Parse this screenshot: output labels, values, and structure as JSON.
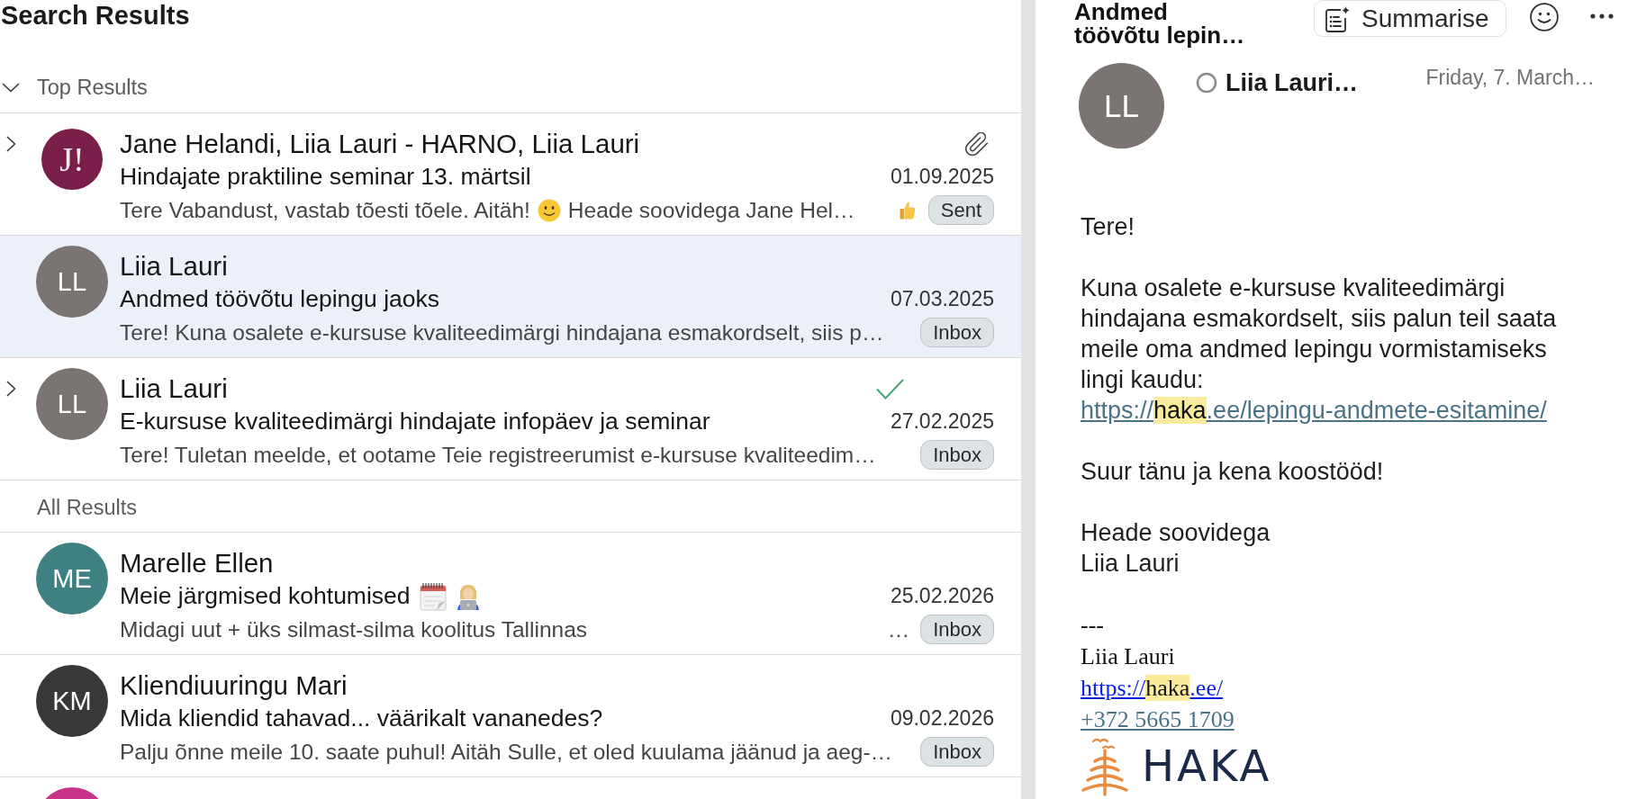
{
  "results": {
    "title": "Search Results",
    "sections": [
      {
        "label": "Top Results",
        "expanded": true,
        "rows": [
          {
            "sender": "Jane Helandi, Liia Lauri - HARNO, Liia Lauri",
            "avatar": {
              "kind": "logo",
              "initials": "J!",
              "color": "#7a1f4a"
            },
            "expanded": false,
            "selected": false,
            "attachment": true,
            "subject": [
              {
                "kind": "text",
                "text": "Hindajate praktiline seminar 13. märtsil"
              }
            ],
            "date": "01.09.2025",
            "preview": [
              {
                "kind": "text",
                "text": "Tere Vabandust, vastab tõesti tõele. Aitäh!"
              },
              {
                "kind": "smile"
              },
              {
                "kind": "text",
                "text": "Heade soovidega Jane Hel…"
              }
            ],
            "reaction": true,
            "folder": "Sent"
          },
          {
            "sender": "Liia Lauri",
            "avatar": {
              "kind": "initials",
              "initials": "LL",
              "color": "#7a7472"
            },
            "selected": true,
            "subject": [
              {
                "kind": "text",
                "text": "Andmed töövõtu lepingu jaoks"
              }
            ],
            "date": "07.03.2025",
            "preview": [
              {
                "kind": "text",
                "text": "Tere! Kuna osalete e-kursuse kvaliteedimärgi hindajana esmakordselt, siis p…"
              }
            ],
            "folder": "Inbox"
          },
          {
            "sender": "Liia Lauri",
            "avatar": {
              "kind": "initials",
              "initials": "LL",
              "color": "#7a7472"
            },
            "expanded": false,
            "selected": false,
            "completed": true,
            "subject": [
              {
                "kind": "text",
                "text": "E-kursuse kvaliteedimärgi hindajate infopäev ja seminar"
              }
            ],
            "date": "27.02.2025",
            "preview": [
              {
                "kind": "text",
                "text": "Tere! Tuletan meelde, et ootame Teie registreerumist e-kursuse kvaliteedim…"
              }
            ],
            "folder": "Inbox"
          }
        ]
      },
      {
        "label": "All Results",
        "rows": [
          {
            "sender": "Marelle Ellen",
            "avatar": {
              "kind": "initials",
              "initials": "ME",
              "color": "#3f8083"
            },
            "selected": false,
            "subject": [
              {
                "kind": "text",
                "text": "Meie järgmised kohtumised"
              },
              {
                "kind": "calendar"
              },
              {
                "kind": "technologist"
              }
            ],
            "date": "25.02.2026",
            "preview": [
              {
                "kind": "text",
                "text": "Midagi uut + üks silmast-silma koolitus Tallinnas"
              },
              {
                "kind": "ellipsis",
                "text": "…"
              }
            ],
            "folder": "Inbox"
          },
          {
            "sender": "Kliendiuuringu Mari",
            "avatar": {
              "kind": "initials",
              "initials": "KM",
              "color": "#383838"
            },
            "selected": false,
            "subject": [
              {
                "kind": "text",
                "text": "Mida kliendid tahavad... väärikalt vananedes?"
              }
            ],
            "date": "09.02.2026",
            "preview": [
              {
                "kind": "text",
                "text": "Palju õnne meile 10. saate puhul! Aitäh Sulle, et oled kuulama jäänud ja aeg-…"
              }
            ],
            "folder": "Inbox"
          },
          {
            "avatar": {
              "kind": "initials",
              "color": "#c8338a"
            },
            "selected": false
          }
        ]
      }
    ]
  },
  "reader": {
    "title": "Andmed töövõtu lepin…",
    "summarise": "Summarise",
    "sender": {
      "initials": "LL",
      "color": "#7a7472",
      "name": "Liia Lauri…",
      "available": false
    },
    "date": "Friday, 7. March…",
    "body": [
      {
        "kind": "paragraph",
        "text": "Tere!"
      },
      {
        "kind": "paragraph",
        "text": "Kuna osalete e-kursuse kvaliteedimärgi hindajana esmakordselt, siis palun teil saata meile oma andmed lepingu vormistamiseks lingi kaudu:",
        "link": [
          {
            "text": "https://",
            "highlighted": false
          },
          {
            "text": "haka",
            "highlighted": true
          },
          {
            "text": ".ee/lepingu-andmete-esitamine/",
            "highlighted": false
          }
        ]
      },
      {
        "kind": "paragraph",
        "text": "Suur tänu ja kena koostööd!"
      },
      {
        "kind": "line",
        "text": "Heade soovidega"
      },
      {
        "kind": "paragraph",
        "text": "Liia Lauri"
      }
    ],
    "signature": {
      "separator": "---",
      "name": "Liia Lauri",
      "website": [
        {
          "text": "https://",
          "highlighted": false
        },
        {
          "text": "haka",
          "highlighted": true
        },
        {
          "text": ".ee/",
          "highlighted": false
        }
      ],
      "phone": "+372 5665 1709",
      "logo": "HAKA"
    }
  }
}
